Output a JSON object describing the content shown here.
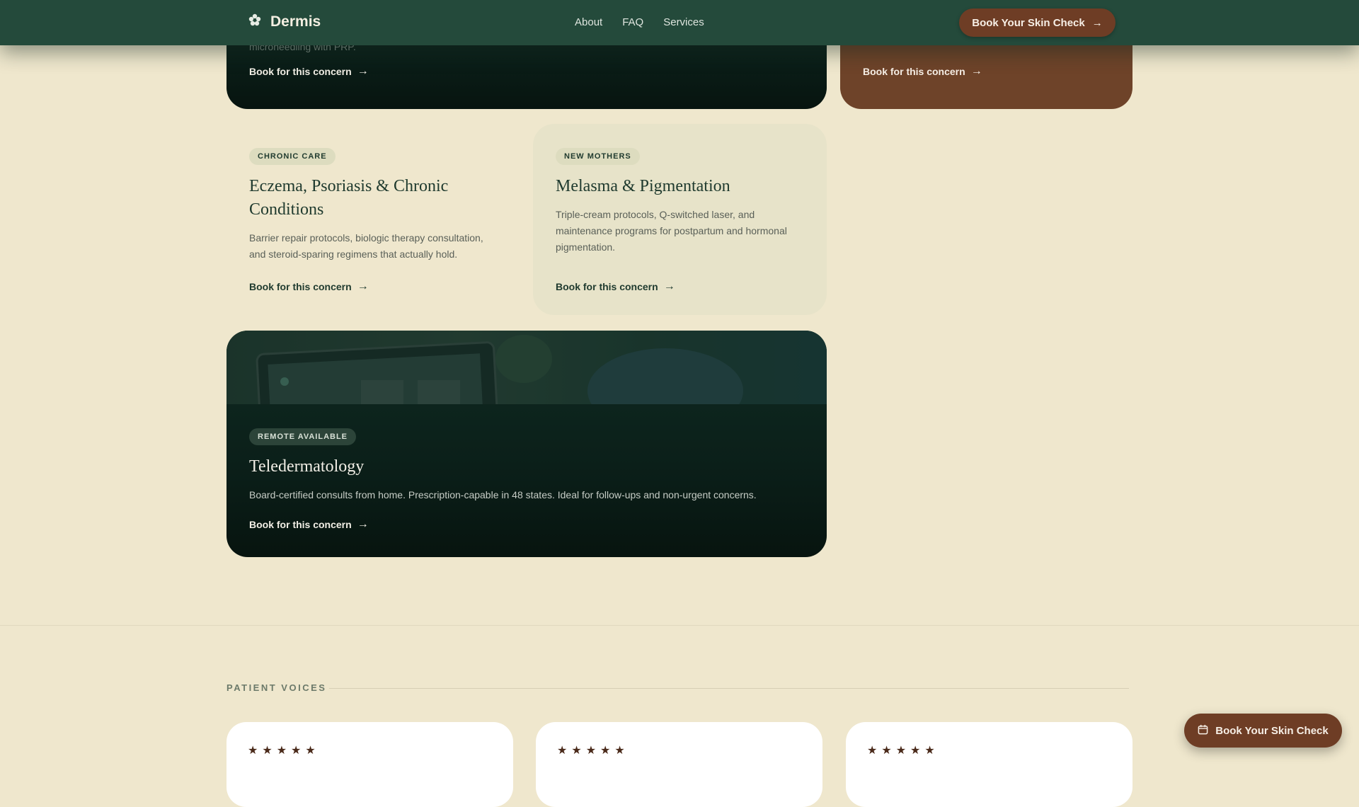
{
  "nav": {
    "brand": "Dermis",
    "links": [
      "About",
      "FAQ",
      "Services"
    ],
    "cta": "Book Your Skin Check",
    "cta_arrow": "→"
  },
  "cards": {
    "top_left": {
      "desc_partial": "microneedling with PRP.",
      "book": "Book for this concern",
      "arrow": "→"
    },
    "top_right": {
      "book": "Book for this concern",
      "arrow": "→"
    },
    "eczema": {
      "tag": "CHRONIC CARE",
      "title_line1": "Eczema, Psoriasis & Chronic",
      "title_line2": "Conditions",
      "desc_line1": "Barrier repair protocols, biologic therapy consultation,",
      "desc_line2": "and steroid-sparing regimens that actually hold.",
      "book": "Book for this concern",
      "arrow": "→"
    },
    "melasma": {
      "tag": "NEW MOTHERS",
      "title": "Melasma & Pigmentation",
      "desc_line1": "Triple-cream protocols, Q-switched laser, and",
      "desc_line2": "maintenance programs for postpartum and hormonal",
      "desc_line3": "pigmentation.",
      "book": "Book for this concern",
      "arrow": "→"
    },
    "tele": {
      "tag": "REMOTE AVAILABLE",
      "title": "Teledermatology",
      "desc": "Board-certified consults from home. Prescription-capable in 48 states. Ideal for follow-ups and non-urgent concerns.",
      "book": "Book for this concern",
      "arrow": "→"
    }
  },
  "testimonials": {
    "label": "PATIENT VOICES",
    "stars": [
      "★★★★★",
      "★★★★★",
      "★★★★★"
    ]
  },
  "floating_cta": "Book Your Skin Check",
  "colors": {
    "background": "#efe7cd",
    "nav": "#244a3b",
    "accent_brown": "#6e3d25",
    "dark_card": "#0b1f19",
    "light_card": "#e7e3c9"
  },
  "icons": {
    "brand": "flower-icon",
    "arrow": "arrow-right-icon",
    "calendar": "calendar-icon",
    "star": "star-icon"
  }
}
